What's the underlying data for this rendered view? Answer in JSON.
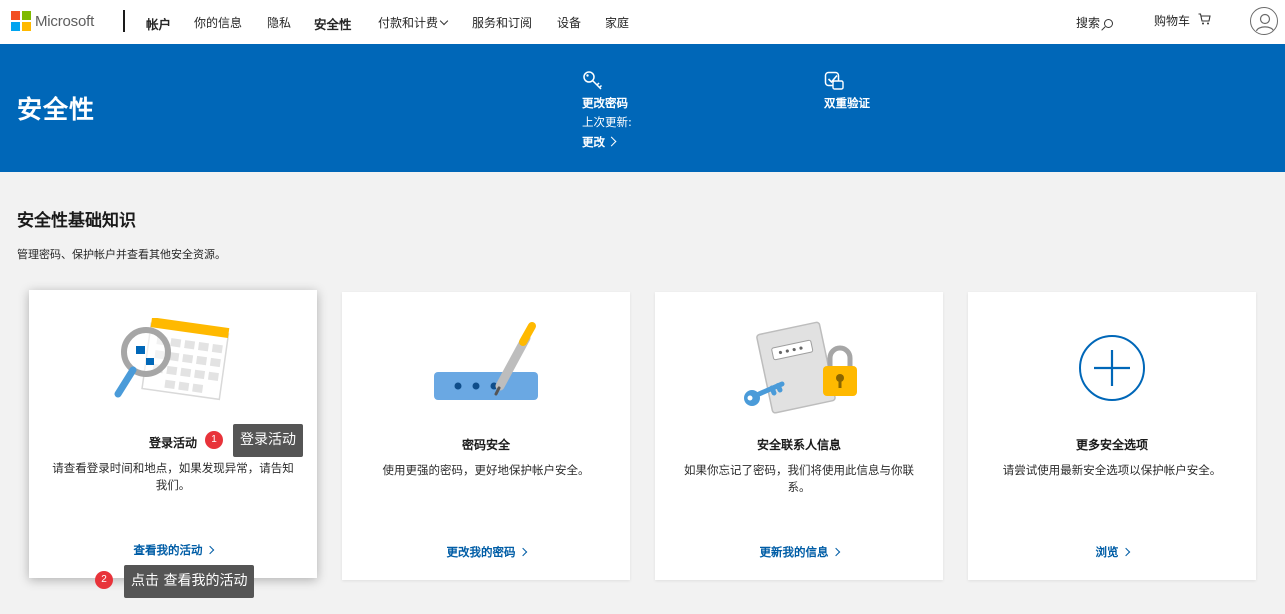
{
  "brand": {
    "name": "Microsoft",
    "colors": [
      "#f25022",
      "#7fba00",
      "#00a4ef",
      "#ffb900"
    ]
  },
  "nav": {
    "account": "帐户",
    "items": [
      "你的信息",
      "隐私",
      "安全性",
      "付款和计费",
      "服务和订阅",
      "设备",
      "家庭"
    ],
    "search": "搜索",
    "cart": "购物车"
  },
  "header": {
    "title": "安全性",
    "password": {
      "label": "更改密码",
      "last_updated": "上次更新:",
      "change": "更改"
    },
    "two_step": {
      "label": "双重验证"
    }
  },
  "main": {
    "title": "安全性基础知识",
    "description": "管理密码、保护帐户并查看其他安全资源。",
    "cards": [
      {
        "title": "登录活动",
        "description": "请查看登录时间和地点，如果发现异常，请告知我们。",
        "link": "查看我的活动"
      },
      {
        "title": "密码安全",
        "description": "使用更强的密码，更好地保护帐户安全。",
        "link": "更改我的密码"
      },
      {
        "title": "安全联系人信息",
        "description": "如果你忘记了密码，我们将使用此信息与你联系。",
        "link": "更新我的信息"
      },
      {
        "title": "更多安全选项",
        "description": "请尝试使用最新安全选项以保护帐户安全。",
        "link": "浏览"
      }
    ]
  },
  "callouts": [
    {
      "number": "1",
      "text": "登录活动"
    },
    {
      "number": "2",
      "text": "点击 查看我的活动"
    }
  ],
  "colors": {
    "accent": "#0067b8",
    "link": "#005da6",
    "background": "#f2f2f2",
    "callout_dot": "#e8333a",
    "callout_bg": "#555555"
  }
}
